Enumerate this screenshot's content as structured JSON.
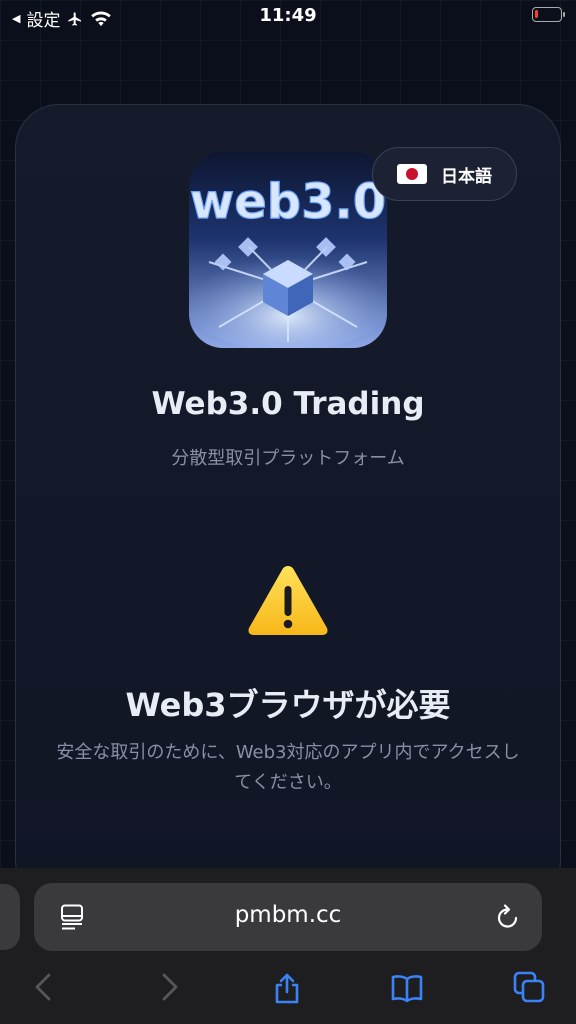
{
  "status_bar": {
    "back_app": "設定",
    "time": "11:49",
    "battery_level": 0.15,
    "battery_color": "#ff3b30"
  },
  "language_button": {
    "label": "日本語",
    "flag": "japan-flag-icon"
  },
  "app": {
    "logo_text": "web3.0",
    "title": "Web3.0 Trading",
    "subtitle": "分散型取引プラットフォーム"
  },
  "warning": {
    "icon": "warning-icon",
    "heading": "Web3ブラウザが必要",
    "description": "安全な取引のために、Web3対応のアプリ内でアクセスしてください。"
  },
  "browser": {
    "url": "pmbm.cc",
    "icons": [
      "reader-icon",
      "reload-icon",
      "back-icon",
      "forward-icon",
      "share-icon",
      "bookmarks-icon",
      "tabs-icon"
    ],
    "accent_color": "#3b82f6"
  }
}
